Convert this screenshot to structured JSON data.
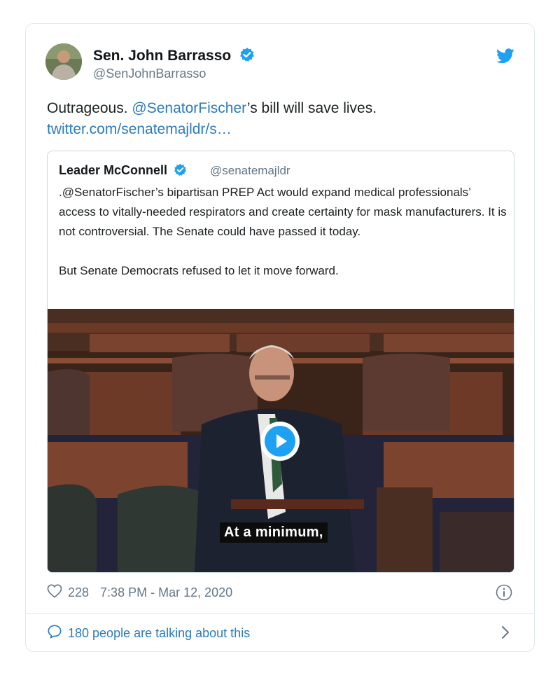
{
  "author": {
    "name": "Sen. John Barrasso",
    "handle": "@SenJohnBarrasso"
  },
  "tweet": {
    "text_before": "Outrageous. ",
    "mention": "@SenatorFischer",
    "text_after": "’s bill will save lives.",
    "link": "twitter.com/senatemajldr/s…"
  },
  "quoted": {
    "name": "Leader McConnell",
    "handle": "@senatemajldr",
    "text": ".@SenatorFischer’s bipartisan PREP Act would expand medical professionals’ access to vitally-needed respirators and create certainty for mask manufacturers. It is not controversial. The Senate could have passed it today.\n\nBut Senate Democrats refused to let it move forward.",
    "video_caption": "At a minimum,"
  },
  "meta": {
    "likes": "228",
    "timestamp": "7:38 PM - Mar 12, 2020"
  },
  "conversation": {
    "label": "180 people are talking about this"
  },
  "icons": {
    "verified": "verified-badge-icon",
    "bird": "twitter-bird-icon",
    "play": "play-icon",
    "heart": "heart-icon",
    "info": "info-icon",
    "speech": "speech-bubble-icon",
    "chevron": "chevron-right-icon"
  },
  "colors": {
    "link": "#2b7bb9",
    "verified": "#1da1f2",
    "secondary_text": "#657786",
    "border": "#e1e8ed"
  }
}
